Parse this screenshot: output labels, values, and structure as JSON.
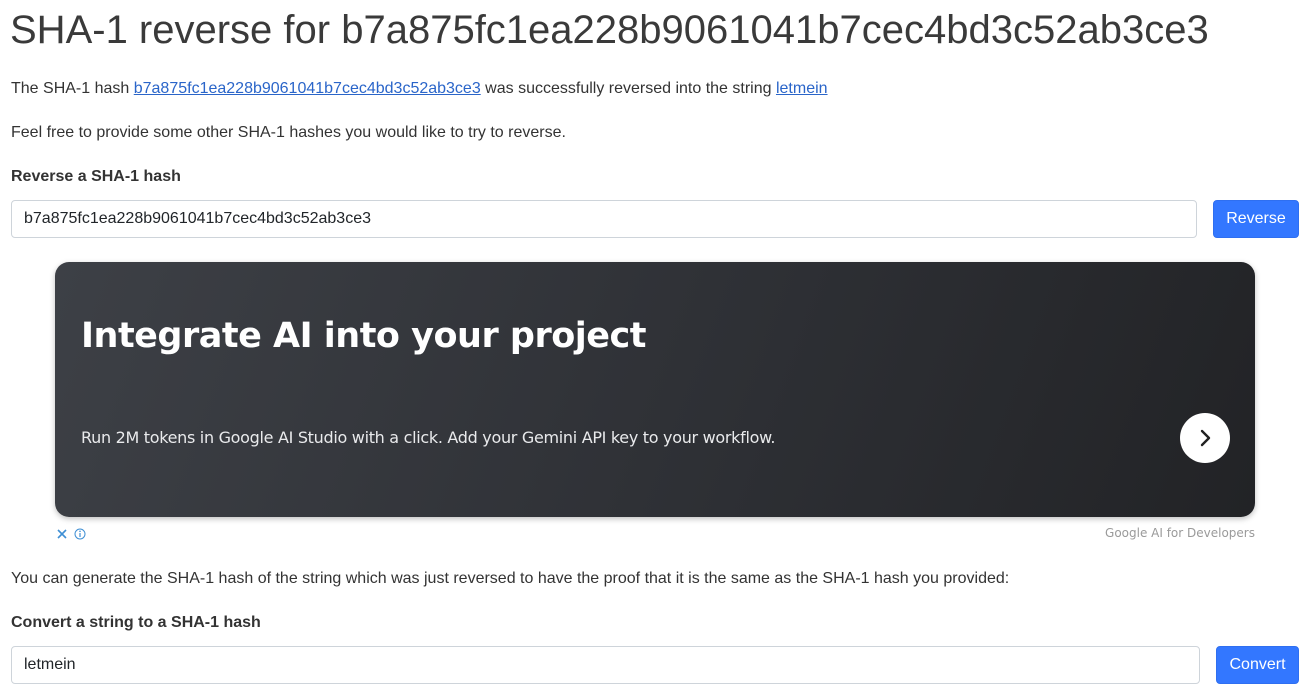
{
  "page": {
    "title": "SHA-1 reverse for b7a875fc1ea228b9061041b7cec4bd3c52ab3ce3"
  },
  "result": {
    "prefix": "The SHA-1 hash ",
    "hash_link": "b7a875fc1ea228b9061041b7cec4bd3c52ab3ce3",
    "middle": " was successfully reversed into the string ",
    "string_link": "letmein"
  },
  "hint": "Feel free to provide some other SHA-1 hashes you would like to try to reverse.",
  "reverse_form": {
    "label": "Reverse a SHA-1 hash",
    "input_value": "b7a875fc1ea228b9061041b7cec4bd3c52ab3ce3",
    "button_label": "Reverse"
  },
  "ad": {
    "headline": "Integrate AI into your project",
    "body": "Run 2M tokens in Google AI Studio with a click. Add your Gemini API key to your workflow.",
    "arrow_icon": "chevron-right-icon",
    "close_icon": "close-icon",
    "info_icon": "info-icon",
    "advertiser": "Google AI for Developers"
  },
  "proof_text": "You can generate the SHA-1 hash of the string which was just reversed to have the proof that it is the same as the SHA-1 hash you provided:",
  "convert_form": {
    "label": "Convert a string to a SHA-1 hash",
    "input_value": "letmein",
    "button_label": "Convert"
  },
  "colors": {
    "link": "#2a65c9",
    "button": "#3377ff",
    "ad_background": "#2e3035"
  }
}
